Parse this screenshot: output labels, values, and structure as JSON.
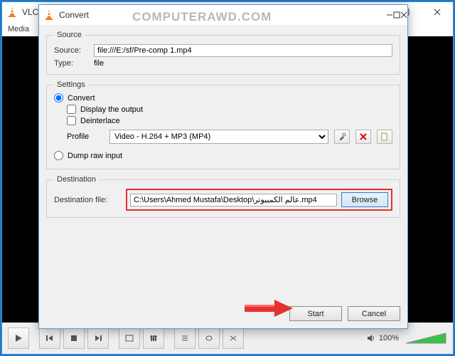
{
  "mainWindow": {
    "title": "VLC media player",
    "menu": {
      "media": "Media"
    }
  },
  "watermark": "COMPUTERAWD.COM",
  "volume": {
    "percent": "100%"
  },
  "dialog": {
    "title": "Convert",
    "source": {
      "legend": "Source",
      "sourceLabel": "Source:",
      "sourceValue": "file:///E:/sf/Pre-comp 1.mp4",
      "typeLabel": "Type:",
      "typeValue": "file"
    },
    "settings": {
      "legend": "Settings",
      "convertLabel": "Convert",
      "displayOutputLabel": "Display the output",
      "deinterlaceLabel": "Deinterlace",
      "profileLabel": "Profile",
      "profileValue": "Video - H.264 + MP3 (MP4)",
      "dumpRawLabel": "Dump raw input"
    },
    "destination": {
      "legend": "Destination",
      "label": "Destination file:",
      "value": "C:\\Users\\Ahmed Mustafa\\Desktop\\عالم الكمبيوتر.mp4",
      "browse": "Browse"
    },
    "buttons": {
      "start": "Start",
      "cancel": "Cancel"
    }
  }
}
